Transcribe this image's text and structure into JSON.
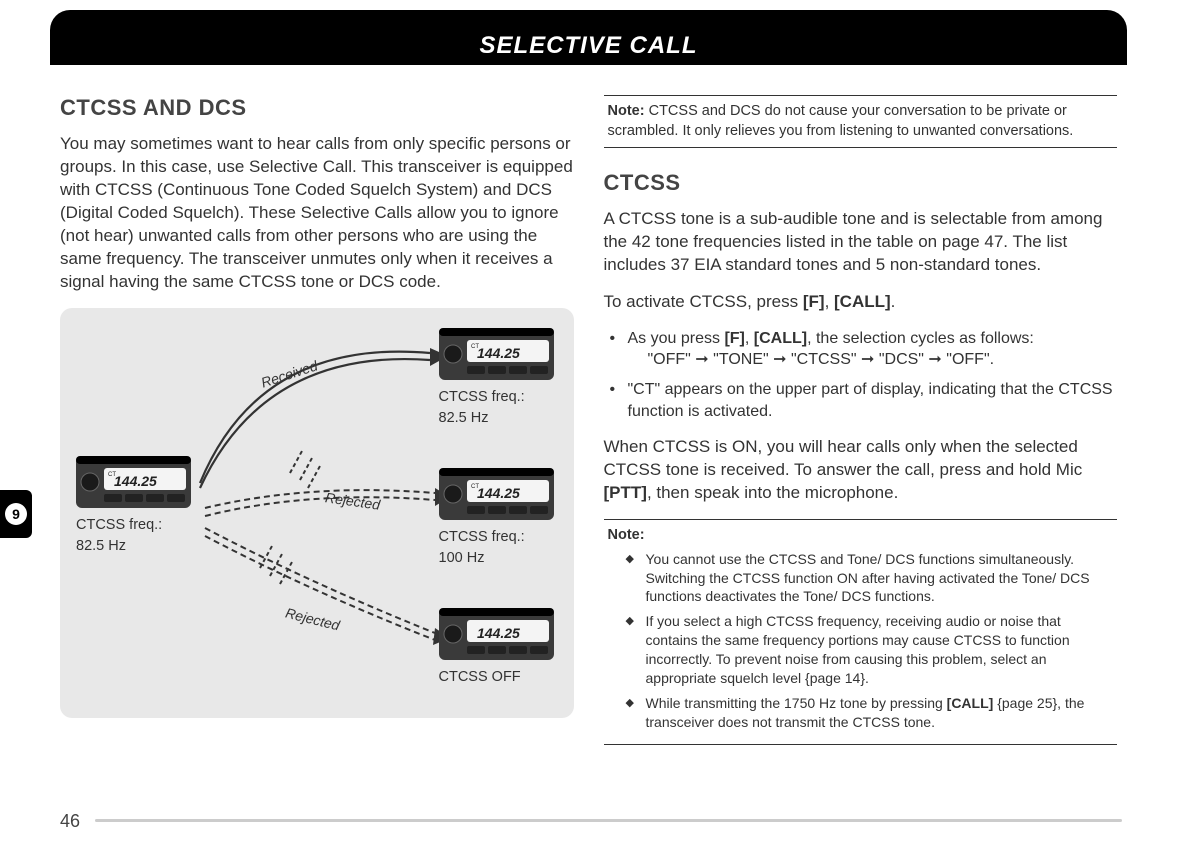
{
  "header": {
    "title": "SELECTIVE CALL"
  },
  "side_tab": {
    "number": "9"
  },
  "page_number": "46",
  "left": {
    "heading": "CTCSS AND DCS",
    "intro": "You may sometimes want to hear calls from only specific persons or groups.  In this case, use Selective Call.  This transceiver is equipped with CTCSS (Continuous Tone Coded Squelch System) and DCS (Digital Coded Squelch).  These Selective Calls allow you to ignore (not hear) unwanted calls from other persons who are using the same frequency.  The transceiver unmutes only when it receives a signal having the same CTCSS tone or DCS code.",
    "diagram": {
      "tx_label_line1": "CTCSS freq.:",
      "tx_label_line2": "82.5 Hz",
      "rx1_label_line1": "CTCSS freq.:",
      "rx1_label_line2": "82.5 Hz",
      "rx2_label_line1": "CTCSS freq.:",
      "rx2_label_line2": "100 Hz",
      "rx3_label": "CTCSS OFF",
      "signal_received": "Received",
      "signal_rejected": "Rejected",
      "display_freq": "144.25",
      "display_ct": "CT"
    }
  },
  "right": {
    "note1_label": "Note:",
    "note1_text": "  CTCSS and DCS do not cause your conversation to be private or scrambled.  It only relieves you from listening to unwanted conversations.",
    "heading": "CTCSS",
    "p1": "A CTCSS tone is a sub-audible tone and is selectable from among the 42 tone frequencies listed in the table on page 47.  The list includes 37 EIA standard tones and 5 non-standard tones.",
    "p2_pre": "To activate CTCSS, press ",
    "p2_b1": "[F]",
    "p2_mid": ", ",
    "p2_b2": "[CALL]",
    "p2_post": ".",
    "li1_pre": "As you press ",
    "li1_b1": "[F]",
    "li1_mid": ", ",
    "li1_b2": "[CALL]",
    "li1_post": ", the selection cycles as follows:",
    "li1_seq": "\"OFF\" ➞ \"TONE\" ➞ \"CTCSS\" ➞ \"DCS\"  ➞ \"OFF\".",
    "li2": "\"CT\" appears on the upper part of display, indicating that the CTCSS function is activated.",
    "p3_pre": "When CTCSS is ON, you will hear calls only when the selected CTCSS tone is received.  To answer the call, press and hold Mic ",
    "p3_b": "[PTT]",
    "p3_post": ", then speak into the microphone.",
    "note2_label": "Note:",
    "note2_items": {
      "n1": "You cannot use the CTCSS and Tone/ DCS functions simultaneously.  Switching the CTCSS function ON after having activated the Tone/ DCS functions deactivates the Tone/ DCS functions.",
      "n2": "If you select a high CTCSS frequency, receiving audio or noise that contains the same frequency portions may cause CTCSS to function incorrectly.  To prevent noise from causing this problem, select an appropriate squelch level {page 14}.",
      "n3_pre": "While transmitting the 1750 Hz tone by pressing ",
      "n3_b": "[CALL]",
      "n3_post": " {page 25}, the transceiver does not transmit the CTCSS tone."
    }
  }
}
